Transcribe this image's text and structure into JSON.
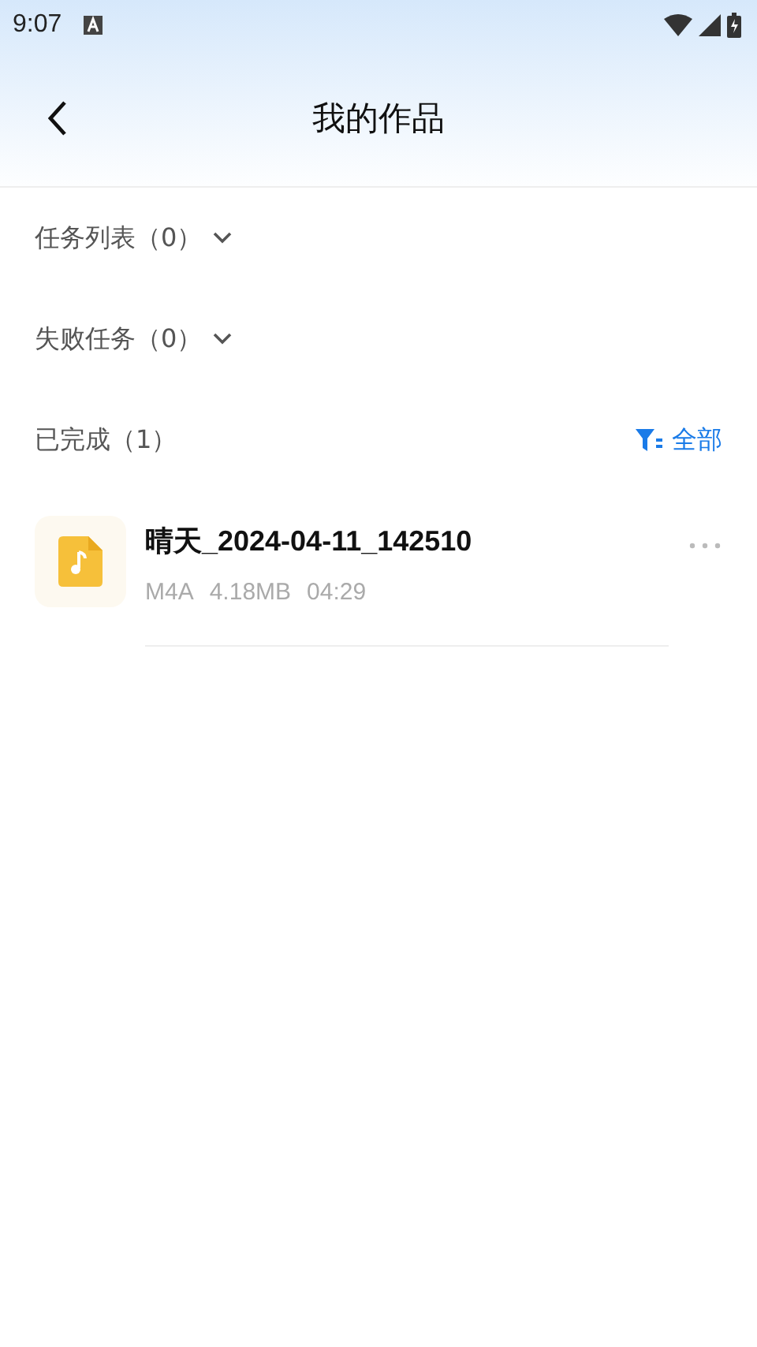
{
  "status_bar": {
    "time": "9:07"
  },
  "header": {
    "title": "我的作品"
  },
  "sections": [
    {
      "kind": "collapsible",
      "label": "任务列表（0）",
      "expanded": false
    },
    {
      "kind": "collapsible",
      "label": "失败任务（0）",
      "expanded": false
    },
    {
      "kind": "filtered",
      "label": "已完成（1）",
      "filter": "全部"
    }
  ],
  "files": [
    {
      "name": "晴天_2024-04-11_142510",
      "format": "M4A",
      "size": "4.18MB",
      "duration": "04:29"
    }
  ]
}
